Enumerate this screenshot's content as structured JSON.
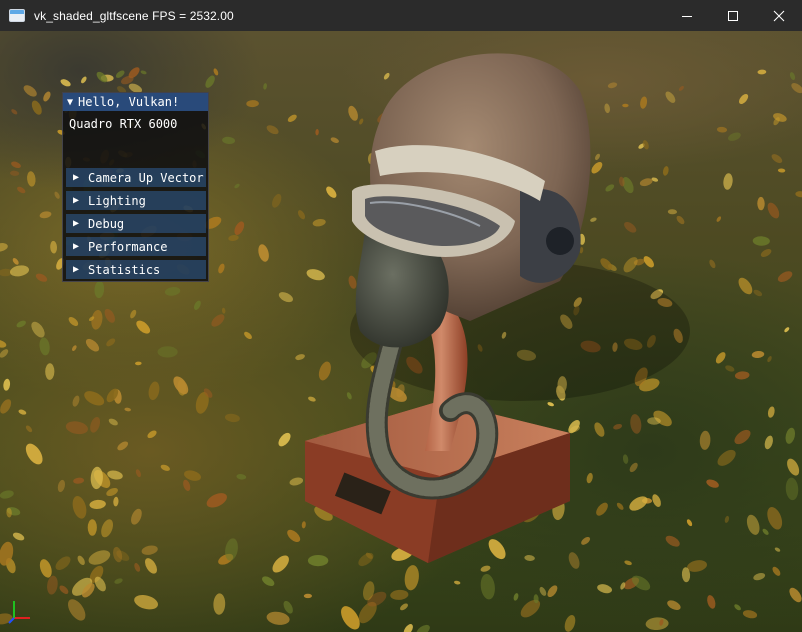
{
  "titlebar": {
    "title": "vk_shaded_gltfscene   FPS = 2532.00",
    "minimize_icon": "minimize-icon",
    "maximize_icon": "maximize-icon",
    "close_icon": "close-icon"
  },
  "imgui": {
    "window_title": "Hello, Vulkan!",
    "collapse_glyph": "▼",
    "gpu_name": "Quadro RTX 6000",
    "expand_glyph": "▶",
    "headers": [
      {
        "label": "Camera Up Vector"
      },
      {
        "label": "Lighting"
      },
      {
        "label": "Debug"
      },
      {
        "label": "Performance"
      },
      {
        "label": "Statistics"
      }
    ]
  },
  "colors": {
    "titlebar_bg": "#2b2b2b",
    "imgui_title_bg": "#294a7a",
    "imgui_header_bg": "#2b4b70",
    "axis_x": "#e02020",
    "axis_y": "#20c020",
    "axis_z": "#2050ff"
  }
}
